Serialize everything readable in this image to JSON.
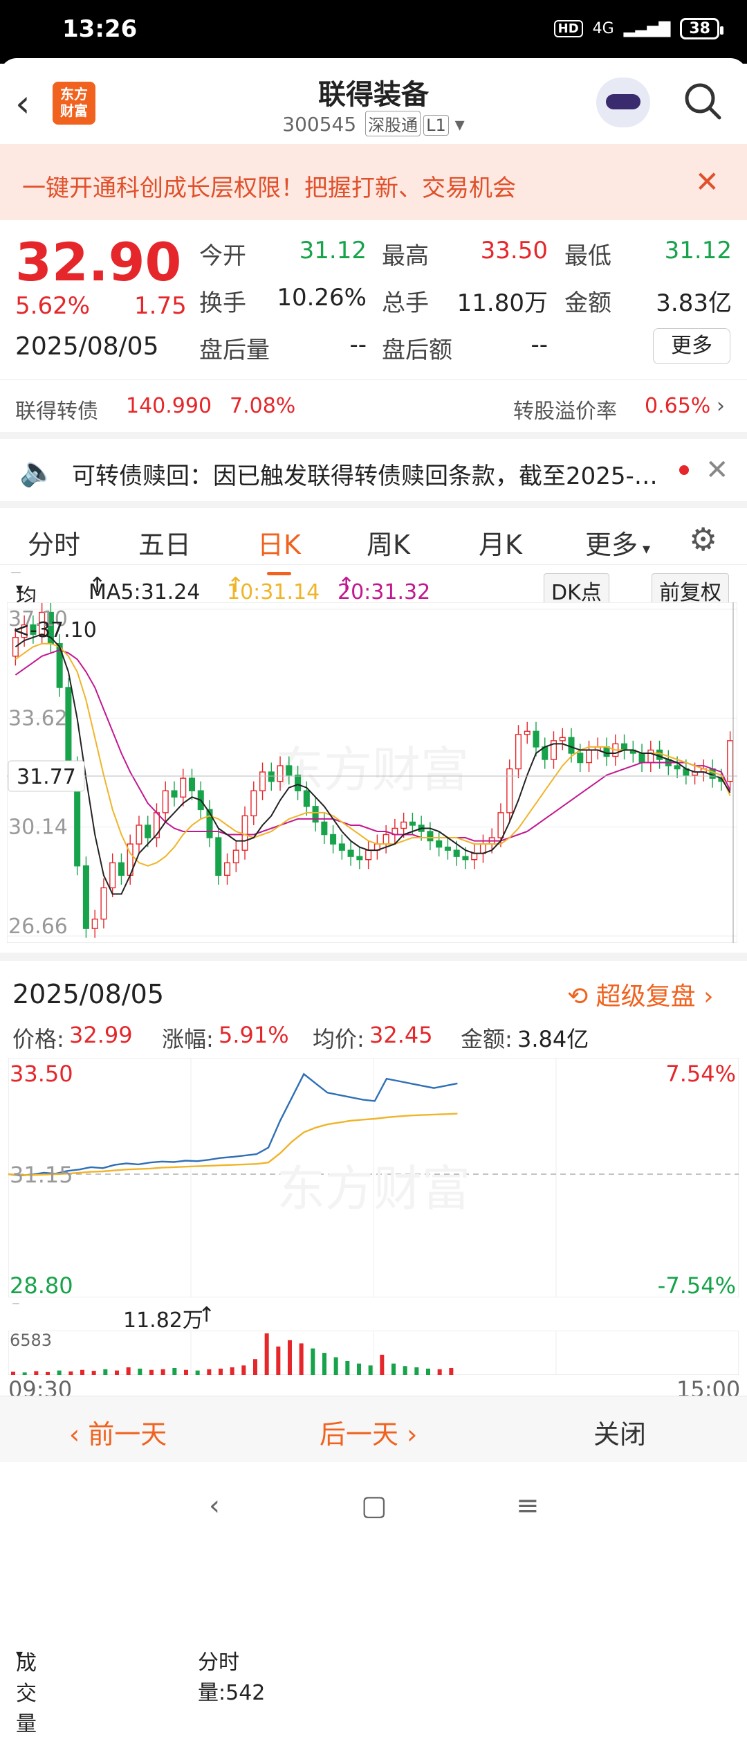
{
  "status": {
    "time": "13:26",
    "hd": "HD",
    "network": "4G",
    "battery": "38"
  },
  "header": {
    "logo_line1": "东方",
    "logo_line2": "财富",
    "stock_name": "联得装备",
    "stock_code": "300545",
    "market_tag": "深股通",
    "level_tag": "L1"
  },
  "banner": {
    "text": "一键开通科创成长层权限！把握打新、交易机会"
  },
  "quote": {
    "price": "32.90",
    "change_pct": "5.62%",
    "change": "1.75",
    "date": "2025/08/05",
    "open_label": "今开",
    "open": "31.12",
    "high_label": "最高",
    "high": "33.50",
    "low_label": "最低",
    "low": "31.12",
    "turnover_label": "换手",
    "turnover": "10.26%",
    "volume_label": "总手",
    "volume": "11.80万",
    "amount_label": "金额",
    "amount": "3.83亿",
    "after_vol_label": "盘后量",
    "after_vol": "--",
    "after_amt_label": "盘后额",
    "after_amt": "--",
    "more_label": "更多"
  },
  "convertible": {
    "name": "联得转债",
    "price": "140.990",
    "pct": "7.08%",
    "premium_label": "转股溢价率",
    "premium": "0.65%"
  },
  "notice": {
    "text": "可转债赎回：因已触发联得转债赎回条款，截至2025-…"
  },
  "tabs": [
    "分时",
    "五日",
    "日K",
    "周K",
    "月K",
    "更多"
  ],
  "ma": {
    "selector": "均线",
    "ma5": "MA5:31.24",
    "ma10": "10:31.14",
    "ma20": "20:31.32",
    "dk": "DK点",
    "adjust": "前复权"
  },
  "kchart_labels": {
    "top": "37.10",
    "max_marker": "<-37.10",
    "l2": "33.62",
    "cur": "31.77",
    "l3": "30.14",
    "bottom": "26.66"
  },
  "detail": {
    "date": "2025/08/05",
    "replay": "超级复盘",
    "price_label": "价格:",
    "price": "32.99",
    "pct_label": "涨幅:",
    "pct": "5.91%",
    "avg_label": "均价:",
    "avg": "32.45",
    "amt_label": "金额:",
    "amt": "3.84亿",
    "top_price": "33.50",
    "top_pct": "7.54%",
    "mid_price": "31.15",
    "bot_price": "28.80",
    "bot_pct": "-7.54%",
    "vol_selector": "成交量",
    "vol_total": "11.82万",
    "tick_vol": "分时量:542",
    "vol_max": "6583",
    "t_start": "09:30",
    "t_end": "15:00"
  },
  "chart_data": [
    {
      "type": "candlestick",
      "title": "日K",
      "ylim": [
        26.66,
        37.1
      ],
      "y_ticks": [
        37.1,
        33.62,
        30.14,
        26.66
      ],
      "series_ma": [
        {
          "name": "MA5",
          "last": 31.24,
          "color": "#222222"
        },
        {
          "name": "MA10",
          "last": 31.14,
          "color": "#f0b429"
        },
        {
          "name": "MA20",
          "last": 31.32,
          "color": "#c2188f"
        }
      ],
      "closes": [
        36.2,
        36.6,
        36.3,
        37.0,
        36.0,
        34.6,
        32.1,
        28.9,
        26.9,
        27.2,
        28.2,
        29.0,
        28.6,
        29.6,
        30.2,
        29.8,
        30.6,
        31.3,
        31.1,
        31.7,
        31.3,
        30.7,
        29.8,
        28.6,
        29.0,
        29.4,
        30.5,
        31.3,
        31.9,
        31.6,
        32.1,
        31.8,
        31.3,
        30.8,
        30.3,
        29.9,
        29.6,
        29.4,
        29.2,
        29.1,
        29.4,
        29.6,
        29.9,
        30.1,
        30.3,
        30.2,
        30.0,
        29.7,
        29.5,
        29.4,
        29.2,
        29.1,
        29.3,
        29.6,
        29.8,
        30.6,
        32.0,
        33.1,
        33.2,
        32.7,
        32.3,
        32.9,
        33.0,
        32.5,
        32.2,
        32.6,
        32.7,
        32.4,
        32.8,
        32.6,
        32.5,
        32.2,
        32.6,
        32.3,
        32.1,
        32.0,
        31.8,
        31.9,
        32.0,
        31.7,
        31.6,
        32.9
      ],
      "ma5": [
        35.9,
        36.1,
        36.2,
        36.3,
        36.2,
        35.9,
        35.1,
        33.6,
        31.7,
        29.9,
        28.6,
        28.0,
        28.0,
        28.6,
        29.3,
        29.6,
        29.9,
        30.3,
        30.6,
        30.9,
        31.1,
        31.0,
        30.6,
        30.1,
        29.9,
        29.7,
        29.7,
        29.8,
        30.2,
        30.5,
        31.0,
        31.4,
        31.5,
        31.4,
        31.1,
        30.8,
        30.4,
        30.0,
        29.7,
        29.5,
        29.4,
        29.4,
        29.5,
        29.6,
        29.9,
        30.0,
        30.1,
        30.1,
        30.0,
        29.8,
        29.6,
        29.4,
        29.3,
        29.3,
        29.4,
        29.7,
        30.3,
        31.0,
        31.8,
        32.5,
        32.7,
        32.8,
        32.8,
        32.7,
        32.6,
        32.6,
        32.6,
        32.5,
        32.5,
        32.6,
        32.6,
        32.5,
        32.5,
        32.4,
        32.3,
        32.2,
        32.0,
        31.9,
        31.9,
        31.8,
        31.7,
        31.24
      ],
      "ma10": [
        35.5,
        35.7,
        35.9,
        36.0,
        36.0,
        35.9,
        35.6,
        35.1,
        34.2,
        33.0,
        31.8,
        30.7,
        29.9,
        29.3,
        29.0,
        28.9,
        29.0,
        29.2,
        29.5,
        29.9,
        30.2,
        30.4,
        30.5,
        30.4,
        30.2,
        30.0,
        29.9,
        29.8,
        29.9,
        30.0,
        30.2,
        30.4,
        30.5,
        30.6,
        30.6,
        30.6,
        30.5,
        30.3,
        30.1,
        29.9,
        29.7,
        29.6,
        29.6,
        29.6,
        29.7,
        29.8,
        29.8,
        29.8,
        29.8,
        29.8,
        29.8,
        29.7,
        29.6,
        29.6,
        29.6,
        29.6,
        29.8,
        30.1,
        30.5,
        30.9,
        31.3,
        31.7,
        32.1,
        32.4,
        32.6,
        32.7,
        32.7,
        32.7,
        32.6,
        32.6,
        32.6,
        32.5,
        32.5,
        32.5,
        32.4,
        32.3,
        32.2,
        32.1,
        32.0,
        31.9,
        31.8,
        31.14
      ],
      "ma20": [
        35.0,
        35.2,
        35.4,
        35.6,
        35.7,
        35.8,
        35.7,
        35.5,
        35.1,
        34.6,
        33.9,
        33.2,
        32.5,
        31.9,
        31.4,
        30.9,
        30.6,
        30.3,
        30.1,
        30.0,
        30.0,
        30.0,
        30.0,
        30.0,
        29.9,
        29.9,
        29.9,
        29.9,
        30.0,
        30.1,
        30.2,
        30.3,
        30.4,
        30.4,
        30.4,
        30.4,
        30.4,
        30.3,
        30.2,
        30.2,
        30.1,
        30.0,
        30.0,
        29.9,
        29.9,
        29.9,
        29.8,
        29.8,
        29.8,
        29.8,
        29.8,
        29.8,
        29.7,
        29.7,
        29.7,
        29.7,
        29.8,
        29.9,
        30.0,
        30.2,
        30.4,
        30.6,
        30.8,
        31.0,
        31.2,
        31.4,
        31.6,
        31.8,
        31.9,
        32.0,
        32.1,
        32.2,
        32.2,
        32.2,
        32.2,
        32.2,
        32.2,
        32.1,
        32.1,
        32.0,
        31.9,
        31.32
      ]
    },
    {
      "type": "line",
      "title": "分时",
      "ylim": [
        28.8,
        33.5
      ],
      "baseline": 31.15,
      "x_range": [
        "09:30",
        "15:00"
      ],
      "series": [
        {
          "name": "价格",
          "color": "#2f6fb6",
          "values": [
            31.15,
            31.12,
            31.14,
            31.18,
            31.16,
            31.22,
            31.25,
            31.3,
            31.28,
            31.35,
            31.38,
            31.36,
            31.4,
            31.42,
            31.41,
            31.44,
            31.43,
            31.46,
            31.5,
            31.52,
            31.55,
            31.58,
            31.72,
            32.3,
            32.8,
            33.3,
            33.1,
            32.9,
            32.85,
            32.8,
            32.75,
            32.72,
            33.2,
            33.15,
            33.1,
            33.05,
            33.0,
            33.05,
            33.1
          ]
        },
        {
          "name": "均价",
          "color": "#f0b429",
          "values": [
            31.15,
            31.13,
            31.13,
            31.14,
            31.15,
            31.16,
            31.18,
            31.2,
            31.21,
            31.23,
            31.25,
            31.26,
            31.27,
            31.29,
            31.3,
            31.31,
            31.32,
            31.33,
            31.34,
            31.35,
            31.36,
            31.37,
            31.4,
            31.6,
            31.85,
            32.05,
            32.15,
            32.22,
            32.26,
            32.3,
            32.32,
            32.34,
            32.37,
            32.39,
            32.41,
            32.42,
            32.43,
            32.44,
            32.45
          ]
        }
      ],
      "volume_max": 6583,
      "volumes": [
        500,
        400,
        600,
        450,
        700,
        550,
        800,
        650,
        900,
        700,
        1200,
        1000,
        800,
        900,
        1100,
        800,
        700,
        900,
        1000,
        1200,
        1500,
        2500,
        6583,
        4500,
        5500,
        5000,
        4200,
        3500,
        2800,
        2200,
        1800,
        1500,
        3200,
        1800,
        1400,
        1200,
        1000,
        900,
        1100
      ]
    }
  ]
}
